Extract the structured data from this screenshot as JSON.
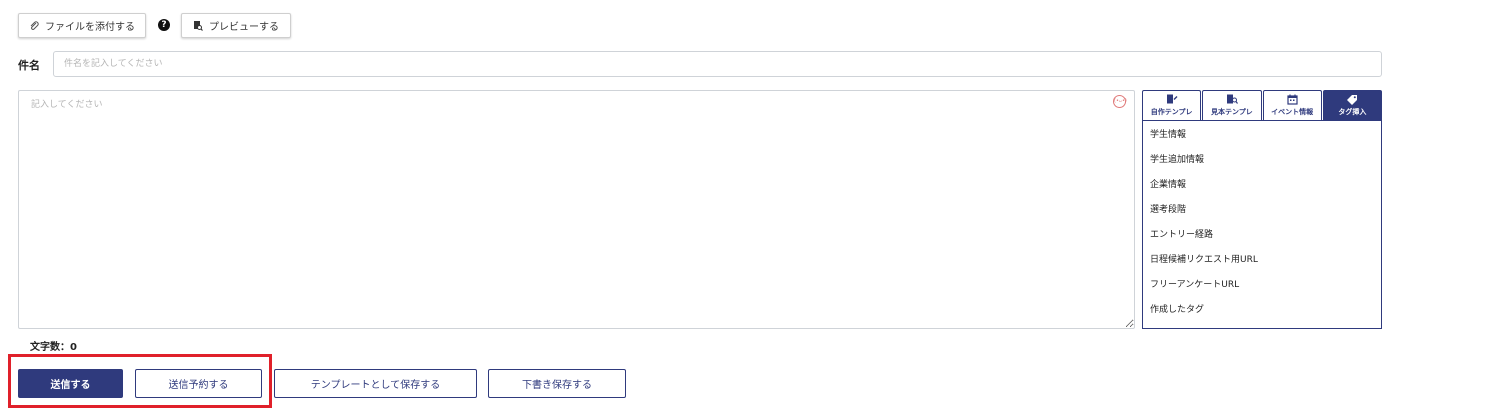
{
  "toolbar": {
    "attach_label": "ファイルを添付する",
    "preview_label": "プレビューする",
    "help_glyph": "?"
  },
  "subject": {
    "label": "件名",
    "value": "",
    "placeholder": "件名を記入してください"
  },
  "body": {
    "value": "",
    "placeholder": "記入してください",
    "emoji_icon_text": "(•ᴗ•)"
  },
  "side_panel": {
    "tabs": [
      {
        "label": "自作テンプレ",
        "icon": "document-edit-icon",
        "active": false
      },
      {
        "label": "見本テンプレ",
        "icon": "document-search-icon",
        "active": false
      },
      {
        "label": "イベント情報",
        "icon": "calendar-icon",
        "active": false
      },
      {
        "label": "タグ挿入",
        "icon": "tag-icon",
        "active": true
      }
    ],
    "tags": [
      "学生情報",
      "学生追加情報",
      "企業情報",
      "選考段階",
      "エントリー経路",
      "日程候補リクエスト用URL",
      "フリーアンケートURL",
      "作成したタグ"
    ]
  },
  "char_count": {
    "label": "文字数：",
    "value": "0"
  },
  "actions": {
    "send_label": "送信する",
    "schedule_label": "送信予約する",
    "save_template_label": "テンプレートとして保存する",
    "save_draft_label": "下書き保存する"
  },
  "colors": {
    "primary": "#2f3a7d",
    "highlight": "#e0202a"
  }
}
